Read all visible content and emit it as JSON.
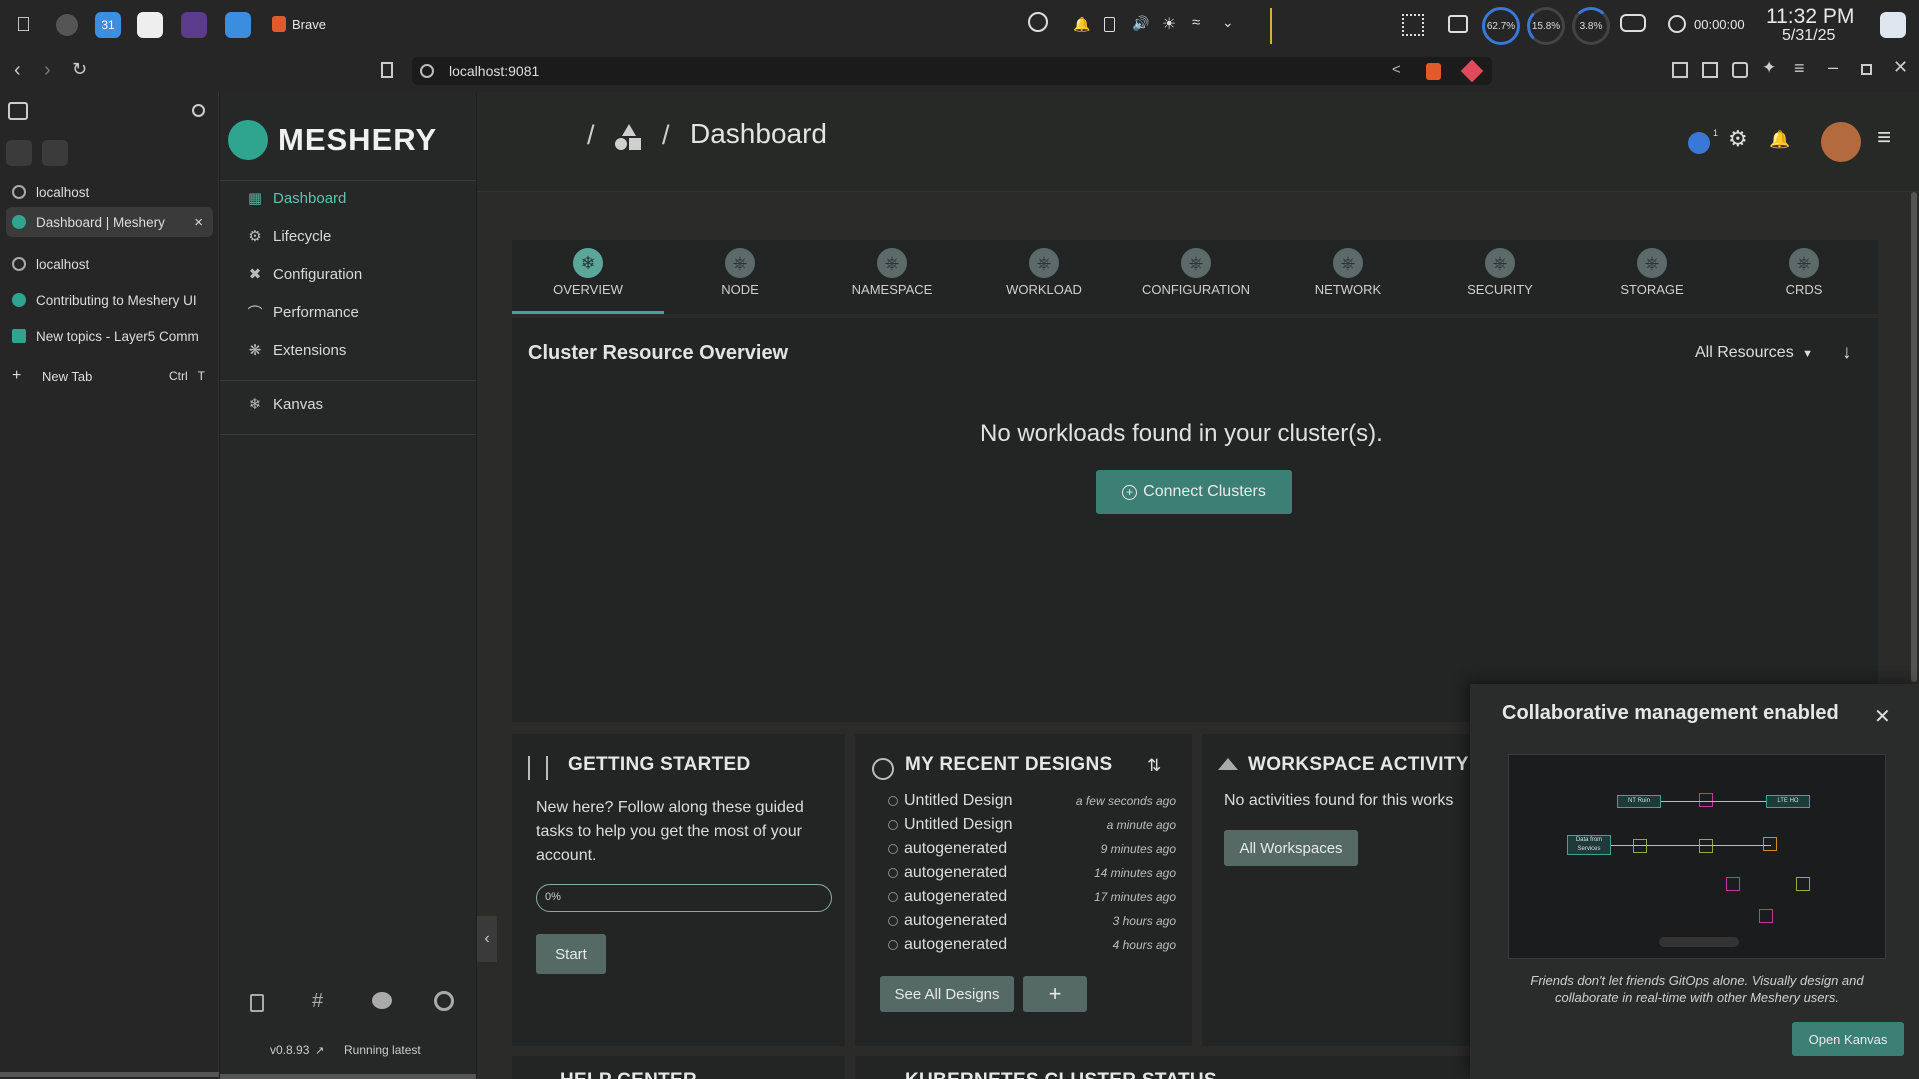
{
  "system": {
    "app_name": "Brave",
    "cpu_pct": "62.7%",
    "mem_pct": "15.8%",
    "disk_pct": "3.8%",
    "timer": "00:00:00",
    "time": "11:32 PM",
    "date": "5/31/25",
    "calendar_day": "31"
  },
  "browser": {
    "url": "localhost:9081",
    "tabs": [
      {
        "label": "localhost"
      },
      {
        "label": "Dashboard | Meshery"
      },
      {
        "label": "localhost"
      },
      {
        "label": "Contributing to Meshery UI"
      },
      {
        "label": "New topics - Layer5 Comm"
      }
    ],
    "new_tab_label": "New Tab",
    "new_tab_shortcut_ctrl": "Ctrl",
    "new_tab_shortcut_key": "T",
    "close_glyph": "×"
  },
  "nav": {
    "logo_text": "MESHERY",
    "items": [
      {
        "label": "Dashboard",
        "icon": "dashboard-icon"
      },
      {
        "label": "Lifecycle",
        "icon": "lifecycle-icon"
      },
      {
        "label": "Configuration",
        "icon": "configuration-icon"
      },
      {
        "label": "Performance",
        "icon": "performance-icon"
      },
      {
        "label": "Extensions",
        "icon": "extensions-icon"
      },
      {
        "label": "Kanvas",
        "icon": "kanvas-icon"
      }
    ],
    "version": "v0.8.93",
    "version_status": "Running latest"
  },
  "header": {
    "sep1": "/",
    "sep2": "/",
    "title": "Dashboard",
    "notification_count": "1"
  },
  "resource_tabs": [
    "OVERVIEW",
    "NODE",
    "NAMESPACE",
    "WORKLOAD",
    "CONFIGURATION",
    "NETWORK",
    "SECURITY",
    "STORAGE",
    "CRDS"
  ],
  "overview": {
    "title": "Cluster Resource Overview",
    "filter": "All Resources",
    "empty_message": "No workloads found in your cluster(s).",
    "connect_button": "Connect Clusters"
  },
  "getting_started": {
    "title": "GETTING STARTED",
    "text": "New here? Follow along these guided tasks to help you get the most of your account.",
    "progress": 0,
    "progress_label": "0%",
    "start_button": "Start"
  },
  "recent_designs": {
    "title": "MY RECENT DESIGNS",
    "items": [
      {
        "name": "Untitled Design",
        "time": "a few seconds ago"
      },
      {
        "name": "Untitled Design",
        "time": "a minute ago"
      },
      {
        "name": "autogenerated",
        "time": "9 minutes ago"
      },
      {
        "name": "autogenerated",
        "time": "14 minutes ago"
      },
      {
        "name": "autogenerated",
        "time": "17 minutes ago"
      },
      {
        "name": "autogenerated",
        "time": "3 hours ago"
      },
      {
        "name": "autogenerated",
        "time": "4 hours ago"
      }
    ],
    "see_all_button": "See All Designs",
    "add_button": "+"
  },
  "workspace_activity": {
    "title": "WORKSPACE ACTIVITY",
    "empty_message": "No activities found for this works",
    "all_button": "All Workspaces"
  },
  "bottom_cards": {
    "help_center": "HELP CENTER",
    "kubernetes_status": "KUBERNETES CLUSTER STATUS"
  },
  "popup": {
    "title": "Collaborative management enabled",
    "caption": "Friends don't let friends GitOps alone. Visually design and collaborate in real-time with other Meshery users.",
    "open_button": "Open Kanvas",
    "close_glyph": "✕",
    "preview_nodes": [
      {
        "label": "NT Ruin"
      },
      {
        "label": "LTE HO"
      },
      {
        "label": "Data from Services"
      }
    ]
  },
  "colors": {
    "accent": "#3ea39a",
    "button": "#3c7f74",
    "panel": "#232524"
  }
}
